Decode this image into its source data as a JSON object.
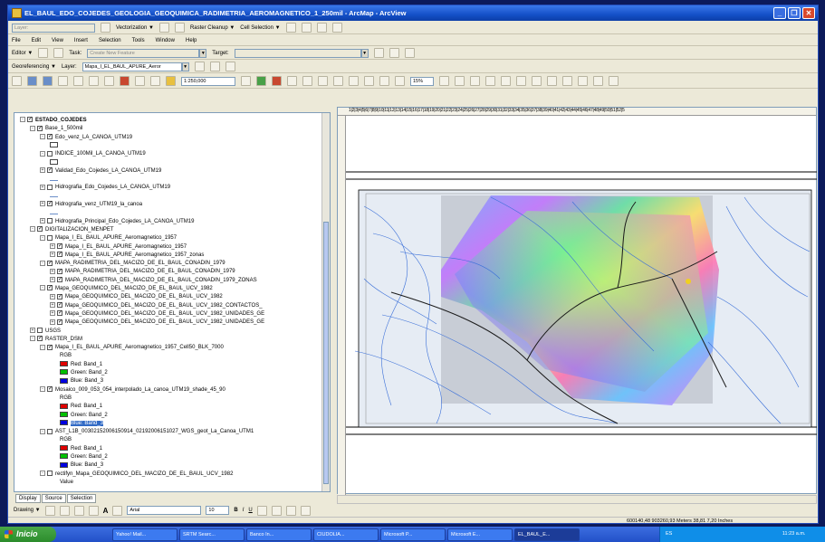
{
  "window": {
    "title": "EL_BAUL_EDO_COJEDES_GEOLOGIA_GEOQUIMICA_RADIMETRIA_AEROMAGNETICO_1_250mil - ArcMap - ArcView"
  },
  "toolbars": {
    "row1": {
      "layer_field": "Layer:",
      "vectorization": "Vectorization ▼",
      "raster_cleanup": "Raster Cleanup ▼",
      "cell_selection": "Cell Selection ▼"
    },
    "menu": [
      "File",
      "Edit",
      "View",
      "Insert",
      "Selection",
      "Tools",
      "Window",
      "Help"
    ],
    "editor": {
      "label": "Editor ▼",
      "task_label": "Task:",
      "task_value": "Create New Feature",
      "target_label": "Target:",
      "target_value": ""
    },
    "georef": {
      "label": "Georeferencing ▼",
      "layer_label": "Layer:",
      "layer_value": "Mapa_I_EL_BAUL_APURE_Aeror"
    },
    "standard": {
      "scale": "1:250,000",
      "zoom": "15%"
    }
  },
  "toc": {
    "rows": [
      {
        "indent": 0,
        "pm": "-",
        "chk": true,
        "text": "ESTADO_COJEDES",
        "bold": true
      },
      {
        "indent": 1,
        "pm": "-",
        "chk": true,
        "text": "Base_1_500mil"
      },
      {
        "indent": 2,
        "pm": "-",
        "chk": true,
        "text": "Edo_venz_LA_CANOA_UTM19"
      },
      {
        "indent": 3,
        "sym": "box"
      },
      {
        "indent": 2,
        "pm": "-",
        "chk": false,
        "text": "INDICE_100Mil_LA_CANOA_UTM19"
      },
      {
        "indent": 3,
        "sym": "box"
      },
      {
        "indent": 2,
        "pm": "+",
        "chk": true,
        "text": "Validad_Edo_Cojedes_LA_CANOA_UTM19"
      },
      {
        "indent": 3,
        "sym": "line"
      },
      {
        "indent": 2,
        "pm": "+",
        "chk": false,
        "text": "Hidrografia_Edo_Cojedes_LA_CANOA_UTM19"
      },
      {
        "indent": 3,
        "sym": "line"
      },
      {
        "indent": 2,
        "pm": "+",
        "chk": true,
        "text": "Hidrografia_venz_UTM19_la_canoa"
      },
      {
        "indent": 3,
        "sym": "line"
      },
      {
        "indent": 2,
        "pm": "+",
        "chk": false,
        "text": "Hidrografia_Principal_Edo_Cojedes_LA_CANOA_UTM19"
      },
      {
        "indent": 1,
        "pm": "-",
        "chk": true,
        "text": "DIGITALIZACION_MENPET"
      },
      {
        "indent": 2,
        "pm": "-",
        "chk": false,
        "text": "Mapa_I_EL_BAUL_APURE_Aeromagnetico_1957"
      },
      {
        "indent": 3,
        "pm": "+",
        "chk": true,
        "text": "Mapa_I_EL_BAUL_APURE_Aeromagnetico_1957"
      },
      {
        "indent": 3,
        "pm": "+",
        "chk": true,
        "text": "Mapa_I_EL_BAUL_APURE_Aeromagnetico_1957_zonas"
      },
      {
        "indent": 2,
        "pm": "-",
        "chk": true,
        "text": "MAPA_RADIMETRIA_DEL_MACIZO_DE_EL_BAUL_CONADIN_1979"
      },
      {
        "indent": 3,
        "pm": "+",
        "chk": true,
        "text": "MAPA_RADIMETRIA_DEL_MACIZO_DE_EL_BAUL_CONADIN_1979"
      },
      {
        "indent": 3,
        "pm": "+",
        "chk": true,
        "text": "MAPA_RADIMETRIA_DEL_MACIZO_DE_EL_BAUL_CONADIN_1979_ZONAS"
      },
      {
        "indent": 2,
        "pm": "-",
        "chk": true,
        "text": "Mapa_GEOQUIMICO_DEL_MACIZO_DE_EL_BAUL_UCV_1982"
      },
      {
        "indent": 3,
        "pm": "+",
        "chk": true,
        "text": "Mapa_GEOQUIMICO_DEL_MACIZO_DE_EL_BAUL_UCV_1982"
      },
      {
        "indent": 3,
        "pm": "+",
        "chk": true,
        "text": "Mapa_GEOQUIMICO_DEL_MACIZO_DE_EL_BAUL_UCV_1982_CONTACTOS_"
      },
      {
        "indent": 3,
        "pm": "+",
        "chk": true,
        "text": "Mapa_GEOQUIMICO_DEL_MACIZO_DE_EL_BAUL_UCV_1982_UNIDADES_GE"
      },
      {
        "indent": 3,
        "pm": "+",
        "chk": true,
        "text": "Mapa_GEOQUIMICO_DEL_MACIZO_DE_EL_BAUL_UCV_1982_UNIDADES_GE"
      },
      {
        "indent": 1,
        "pm": "+",
        "chk": false,
        "text": "USGS"
      },
      {
        "indent": 1,
        "pm": "-",
        "chk": true,
        "text": "RASTER_DSM"
      },
      {
        "indent": 2,
        "pm": "-",
        "chk": true,
        "text": "Mapa_I_EL_BAUL_APURE_Aeromagnetico_1957_Cell50_BLK_7000"
      },
      {
        "indent": 4,
        "text": "RGB"
      },
      {
        "indent": 4,
        "sw": "#e00000",
        "text": "Red:   Band_1"
      },
      {
        "indent": 4,
        "sw": "#00c000",
        "text": "Green: Band_2"
      },
      {
        "indent": 4,
        "sw": "#0000e0",
        "text": "Blue:  Band_3"
      },
      {
        "indent": 2,
        "pm": "-",
        "chk": true,
        "text": "Mosaico_009_053_054_interpolado_La_canoa_UTM19_shade_45_90"
      },
      {
        "indent": 4,
        "text": "RGB"
      },
      {
        "indent": 4,
        "sw": "#e00000",
        "text": "Red:   Band_1"
      },
      {
        "indent": 4,
        "sw": "#00c000",
        "text": "Green: Band_2"
      },
      {
        "indent": 4,
        "sw": "#0000e0",
        "text": "Blue:  Band_3",
        "selected": true
      },
      {
        "indent": 2,
        "pm": "-",
        "chk": false,
        "text": "AST_L1B_00302152006150914_02192006151027_WGS_geot_La_Canoa_UTM1"
      },
      {
        "indent": 4,
        "text": "RGB"
      },
      {
        "indent": 4,
        "sw": "#e00000",
        "text": "Red:   Band_1"
      },
      {
        "indent": 4,
        "sw": "#00c000",
        "text": "Green: Band_2"
      },
      {
        "indent": 4,
        "sw": "#0000e0",
        "text": "Blue:  Band_3"
      },
      {
        "indent": 2,
        "pm": "-",
        "chk": false,
        "text": "rectifyn_Mapa_GEOQUIMICO_DEL_MACIZO_DE_EL_BAUL_UCV_1982"
      },
      {
        "indent": 4,
        "text": "Value"
      }
    ],
    "tabs": [
      "Display",
      "Source",
      "Selection"
    ]
  },
  "ruler": "1|2|3|4|5|6|7|8|9|10|11|12|13|14|15|16|17|18|19|20|21|22|23|24|25|26|27|28|29|30|31|32|33|34|35|36|37|38|39|40|41|42|43|44|45|46|47|48|49|50|51|52|5",
  "drawing": {
    "label": "Drawing ▼",
    "font": "Arial",
    "size": "10"
  },
  "status": {
    "coords": "600140,48  903260,93 Meters   38,81  7,20 Inches"
  },
  "taskbar": {
    "start": "Inicio",
    "tasks": [
      "Yahoo! Mail...",
      "SRTM Searc...",
      "Banco In...",
      "CIUDOLIA...",
      "Microsoft P...",
      "Microsoft E...",
      "EL_BAUL_E..."
    ],
    "active_index": 6,
    "lang": "ES",
    "time": "11:23 a.m."
  },
  "colors": {
    "title": "#1450c8",
    "taskbar": "#2250c8",
    "tray": "#0f8ee8"
  }
}
